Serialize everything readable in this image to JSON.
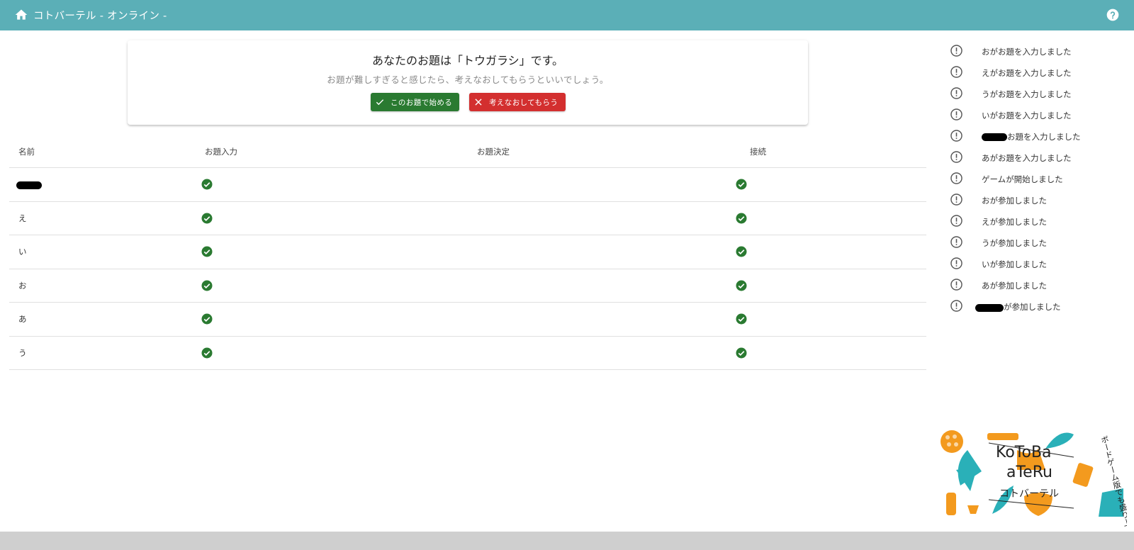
{
  "app": {
    "title": "コトバーテル - オンライン -",
    "home_icon": "home-icon",
    "help_icon": "help-circle-icon",
    "bar_color": "#5bafb7"
  },
  "topic_card": {
    "headline": "あなたのお題は「トウガラシ」です。",
    "subtext": "お題が難しすぎると感じたら、考えなおしてもらうといいでしょう。",
    "start_button": "このお題で始める",
    "retry_button": "考えなおしてもらう",
    "start_color": "#2a7a31",
    "retry_color": "#d32f2f"
  },
  "table": {
    "headers": [
      "名前",
      "お題入力",
      "お題決定",
      "接続"
    ],
    "rows": [
      {
        "name": "",
        "topic_input": true,
        "topic_decided": false,
        "connected": true
      },
      {
        "name": "え",
        "topic_input": true,
        "topic_decided": false,
        "connected": true
      },
      {
        "name": "い",
        "topic_input": true,
        "topic_decided": false,
        "connected": true
      },
      {
        "name": "お",
        "topic_input": true,
        "topic_decided": false,
        "connected": true
      },
      {
        "name": "あ",
        "topic_input": true,
        "topic_decided": false,
        "connected": true
      },
      {
        "name": "う",
        "topic_input": true,
        "topic_decided": false,
        "connected": true
      }
    ],
    "check_color": "#2a7a31"
  },
  "log": [
    "おがお題を入力しました",
    "えがお題を入力しました",
    "うがお題を入力しました",
    "いがお題を入力しました",
    "お題を入力しました",
    "あがお題を入力しました",
    "ゲームが開始しました",
    "おが参加しました",
    "えが参加しました",
    "うが参加しました",
    "いが参加しました",
    "あが参加しました",
    "が参加しました"
  ],
  "logo": {
    "line1": "KoToBa",
    "line2": "aTeRu",
    "line3": "コトバーテル",
    "vertical": "ボードゲーム版でも盛り上がろう！",
    "orange": "#f39a1e",
    "teal": "#2ab0b8"
  }
}
